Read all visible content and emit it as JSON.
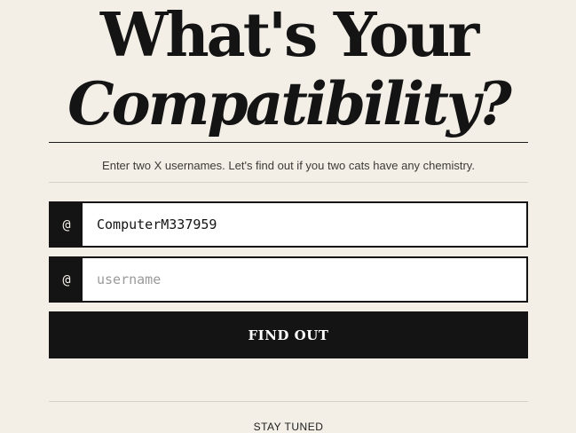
{
  "hero": {
    "title_line1": "What's Your",
    "title_line2": "Compatibility?"
  },
  "subtitle": "Enter two X usernames. Let's find out if you two cats have any chemistry.",
  "form": {
    "prefix_symbol": "@",
    "username1": {
      "value": "ComputerM337959",
      "placeholder": "username"
    },
    "username2": {
      "value": "",
      "placeholder": "username"
    },
    "submit_label": "FIND OUT"
  },
  "footer": {
    "stay_tuned": "STAY TUNED"
  },
  "colors": {
    "background": "#f3efe7",
    "ink": "#141414",
    "input_background": "#ffffff",
    "divider": "#d8d1c6"
  }
}
